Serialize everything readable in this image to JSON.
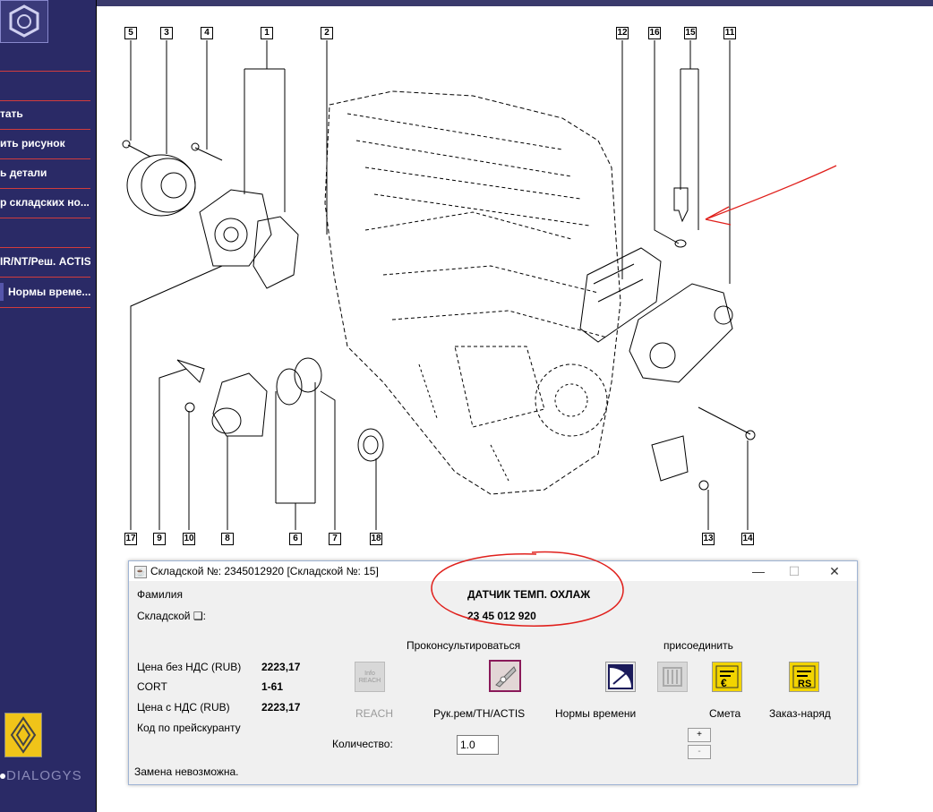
{
  "sidebar": {
    "menu": [
      "тать",
      "ить рисунок",
      "ь детали",
      "р складских но...",
      "IR/NT/Реш. ACTIS"
    ],
    "norms_button": "Нормы време...",
    "brand": "DIALOGYS"
  },
  "diagram": {
    "callouts": [
      "5",
      "3",
      "4",
      "1",
      "2",
      "12",
      "16",
      "15",
      "11",
      "17",
      "9",
      "10",
      "8",
      "6",
      "7",
      "18",
      "13",
      "14"
    ]
  },
  "dialog": {
    "title": "Складской №: 2345012920 [Складской №: 15]",
    "controls": {
      "minimize": "—",
      "maximize": "☐",
      "close": "✕"
    },
    "family_label": "Фамилия",
    "family_value": "ДАТЧИК ТЕМП. ОХЛАЖ",
    "stock_label": "Складской ❑:",
    "stock_value": "23 45 012 920",
    "consult_label": "Проконсультироваться",
    "attach_label": "присоединить",
    "price_excl_label": "Цена без НДС (RUB)",
    "price_excl_value": "2223,17",
    "cort_label": "CORT",
    "cort_value": "1-61",
    "price_incl_label": "Цена с НДС (RUB)",
    "price_incl_value": "2223,17",
    "pricelist_label": "Код по прейскуранту",
    "buttons": {
      "reach": "REACH",
      "reach_icon_text": "Info REACH",
      "manual": "Рук.рем/TH/ACTIS",
      "norms": "Нормы времени",
      "estimate": "Смета",
      "order": "Заказ-наряд"
    },
    "quantity_label": "Количество:",
    "quantity_value": "1.0",
    "spin": {
      "plus": "+",
      "minus": "-"
    },
    "status": "Замена невозможна."
  },
  "colors": {
    "sidebar": "#2a2a66",
    "menu_line": "#d23c3c",
    "annotation": "#e0201c",
    "dialog_bg": "#f0f0f0"
  }
}
